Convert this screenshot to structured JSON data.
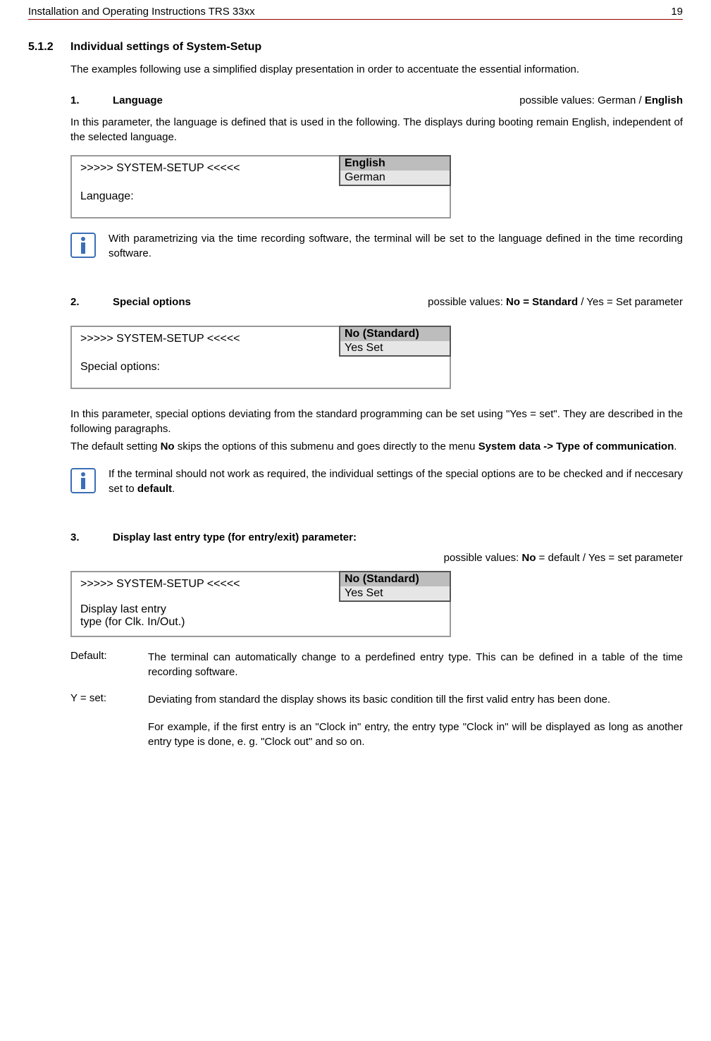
{
  "header": {
    "left": "Installation and Operating Instructions TRS 33xx",
    "right": "19"
  },
  "section": {
    "num": "5.1.2",
    "title": "Individual settings of System-Setup",
    "intro": "The examples following use a simplified display presentation in order to accentuate the essential information."
  },
  "param1": {
    "num": "1.",
    "name": "Language",
    "values_prefix": "possible values: German / ",
    "values_bold": "English",
    "desc": "In this parameter, the language is defined that is used in the following. The displays during booting remain English, independent of the selected language.",
    "display_title": ">>>>> SYSTEM-SETUP <<<<<",
    "display_label": "Language:",
    "opt_selected": "English",
    "opt_other": "German",
    "info": "With parametrizing via the time recording software, the terminal will be set to the language defined in the time recording software."
  },
  "param2": {
    "num": "2.",
    "name": "Special options",
    "values_prefix": "possible values: ",
    "values_bold": "No = Standard",
    "values_suffix": " / Yes = Set parameter",
    "display_title": ">>>>> SYSTEM-SETUP <<<<<",
    "display_label": "Special options:",
    "opt_selected": "No (Standard)",
    "opt_other": "Yes  Set",
    "desc1": "In this parameter, special options deviating from the standard programming can be set using \"Yes = set\". They are  described in the following paragraphs.",
    "desc2a": "The default setting ",
    "desc2b": "No",
    "desc2c": " skips the options of this submenu and goes directly to the menu ",
    "desc2d": "System data -> Type of communication",
    "desc2e": ".",
    "info_a": "If the terminal should not work as required, the individual settings of the special options are to be checked and if neccesary set to ",
    "info_b": "default",
    "info_c": "."
  },
  "param3": {
    "num": "3.",
    "name": "Display last entry type (for entry/exit) parameter:",
    "values_prefix": "possible values: ",
    "values_bold": "No",
    "values_suffix": " = default / Yes = set parameter",
    "display_title": ">>>>> SYSTEM-SETUP <<<<<",
    "display_label1": "Display last entry",
    "display_label2": "type (for Clk. In/Out.)",
    "opt_selected": "No (Standard)",
    "opt_other": "Yes  Set",
    "def_label": "Default:",
    "def_text": "The terminal can automatically change to a perdefined entry type. This can be defined in a table of the time recording software.",
    "set_label": "Y = set:",
    "set_text": "Deviating from standard the display shows its basic condition till the first valid entry has been done.",
    "example": "For example, if the first entry is an \"Clock in\" entry, the entry type \"Clock in\" will be displayed as long as another entry type is done, e. g. \"Clock out\" and so on."
  }
}
